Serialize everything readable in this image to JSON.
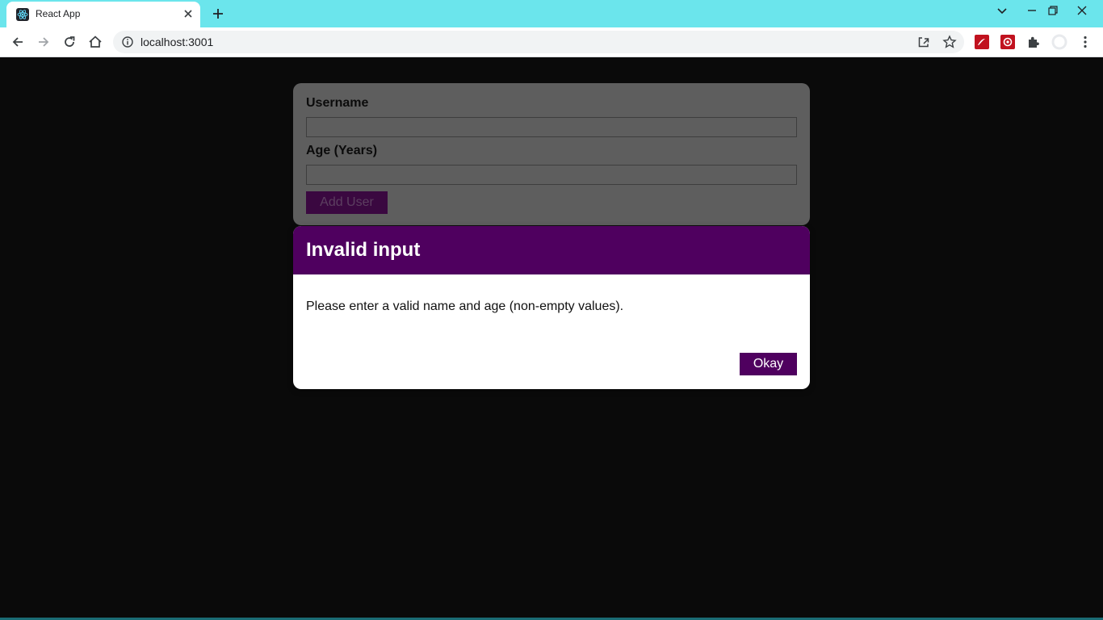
{
  "browser": {
    "tab_title": "React App",
    "url": "localhost:3001",
    "colors": {
      "tabstrip": "#6be5ec",
      "toolbar": "#ffffff"
    }
  },
  "form": {
    "username_label": "Username",
    "username_value": "",
    "age_label": "Age (Years)",
    "age_value": "",
    "submit_label": "Add User"
  },
  "modal": {
    "title": "Invalid input",
    "message": "Please enter a valid name and age (non-empty values).",
    "confirm_label": "Okay",
    "colors": {
      "header": "#4f005f",
      "button": "#4f005f"
    }
  },
  "icons": {
    "favicon": "react-logo-icon",
    "tab_close": "close-icon",
    "new_tab": "plus-icon",
    "back": "arrow-left-icon",
    "forward": "arrow-right-icon",
    "reload": "reload-icon",
    "home": "home-icon",
    "site_info": "info-icon",
    "share": "share-icon",
    "bookmark": "star-icon",
    "pdf_extension": "pdf-icon",
    "extension2": "extension-icon",
    "extensions": "puzzle-icon",
    "profile": "avatar-icon",
    "menu": "kebab-menu-icon"
  }
}
